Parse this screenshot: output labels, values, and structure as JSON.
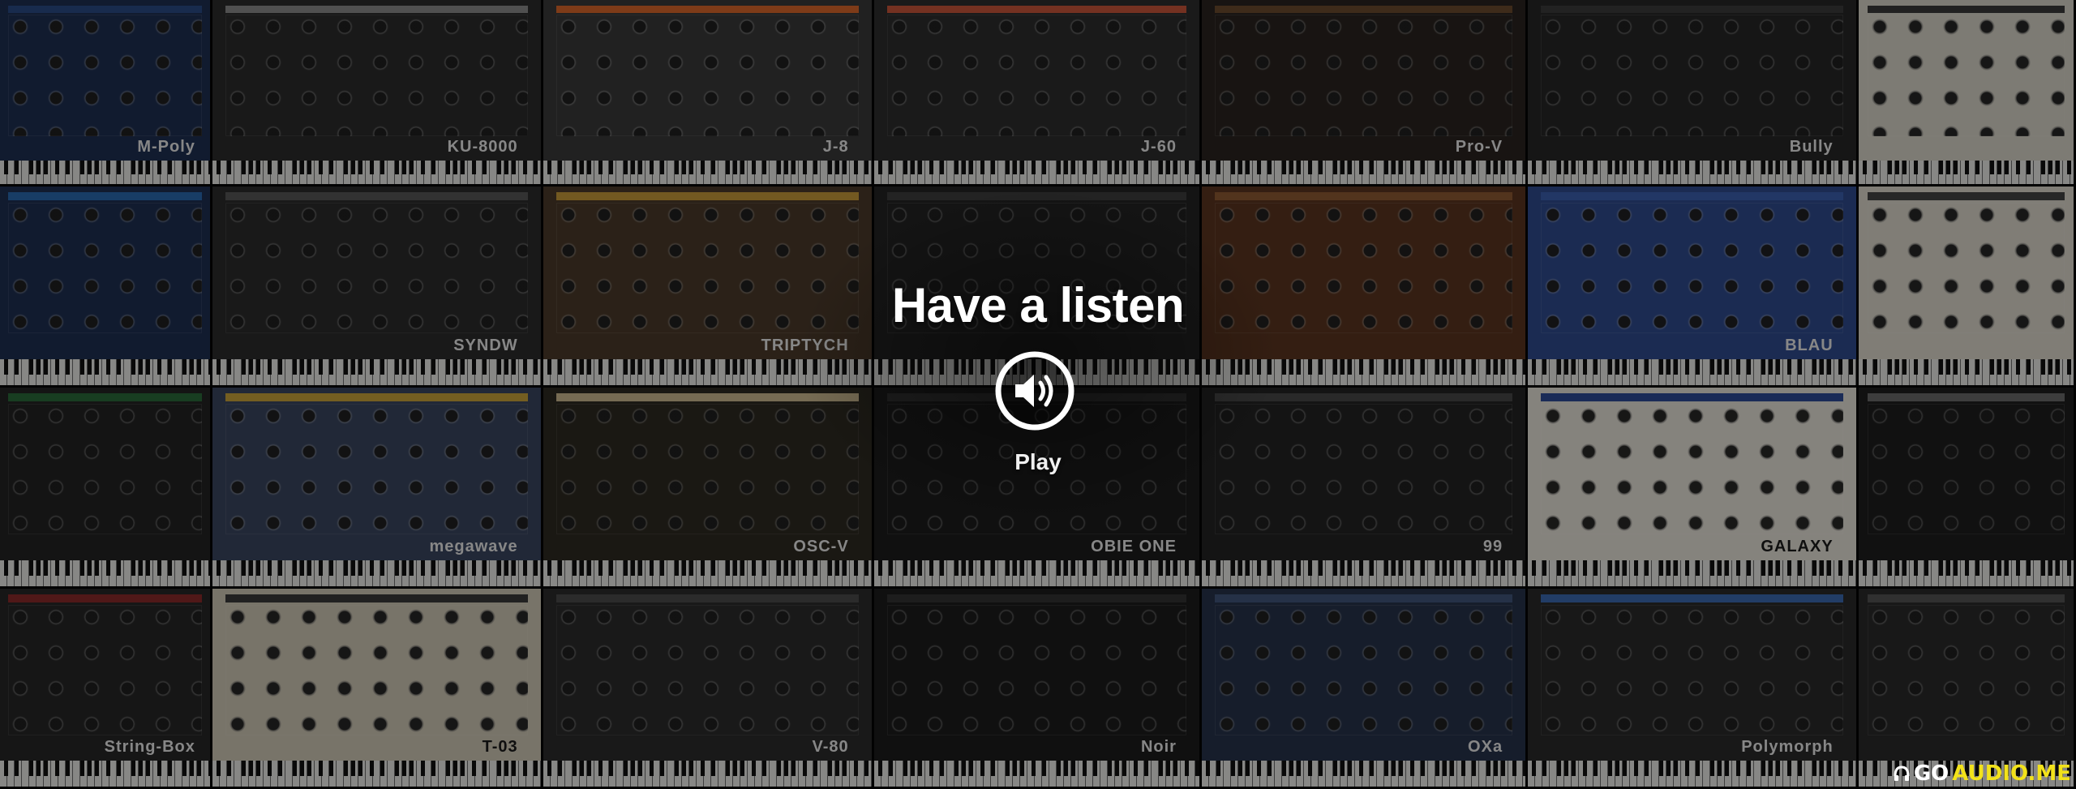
{
  "hero": {
    "headline": "Have a listen",
    "play_label": "Play"
  },
  "watermark": {
    "part1": "GO",
    "part2": "AUDIO.ME"
  },
  "synths": [
    {
      "name": "M-Poly",
      "bg": "#1e2f52",
      "bar": "#2a4a86",
      "light": false
    },
    {
      "name": "KU-8000",
      "bg": "#2b2b2b",
      "bar": "#8a8a8a",
      "light": false
    },
    {
      "name": "J-8",
      "bg": "#3a3a3a",
      "bar": "#d9662a",
      "light": false
    },
    {
      "name": "J-60",
      "bg": "#2d2d2d",
      "bar": "#c8553a",
      "light": false
    },
    {
      "name": "Pro-V",
      "bg": "#2a2420",
      "bar": "#6b4a2d",
      "light": false
    },
    {
      "name": "Bully",
      "bg": "#262626",
      "bar": "#3b3b3b",
      "light": false
    },
    {
      "name": "",
      "bg": "#d8d4c8",
      "bar": "#3a3a3a",
      "light": true
    },
    {
      "name": "",
      "bg": "#1e2f52",
      "bar": "#2a6ab0",
      "light": false
    },
    {
      "name": "SYNDW",
      "bg": "#2b2b2b",
      "bar": "#575757",
      "light": false
    },
    {
      "name": "TRIPTYCH",
      "bg": "#4a3a2a",
      "bar": "#c79a3a",
      "light": false
    },
    {
      "name": "",
      "bg": "#232323",
      "bar": "#3d3d3d",
      "light": false
    },
    {
      "name": "",
      "bg": "#5a3520",
      "bar": "#8e5a32",
      "light": false
    },
    {
      "name": "BLAU",
      "bg": "#2f4a8e",
      "bar": "#3b5fae",
      "light": false
    },
    {
      "name": "",
      "bg": "#dcd8cc",
      "bar": "#444444",
      "light": true
    },
    {
      "name": "",
      "bg": "#232323",
      "bar": "#2a6a3a",
      "light": false
    },
    {
      "name": "megawave",
      "bg": "#3a4660",
      "bar": "#c8a23a",
      "light": false
    },
    {
      "name": "OSC-V",
      "bg": "#2e2a22",
      "bar": "#cbb890",
      "light": false
    },
    {
      "name": "OBIE ONE",
      "bg": "#1c1c1c",
      "bar": "#333333",
      "light": false
    },
    {
      "name": "99",
      "bg": "#242424",
      "bar": "#474747",
      "light": false
    },
    {
      "name": "GALAXY",
      "bg": "#e6e2d8",
      "bar": "#2e4a96",
      "light": true
    },
    {
      "name": "",
      "bg": "#1e1e1e",
      "bar": "#6a6a6a",
      "light": false
    },
    {
      "name": "String-Box",
      "bg": "#262626",
      "bar": "#8a2a2a",
      "light": false
    },
    {
      "name": "T-03",
      "bg": "#cfc8b6",
      "bar": "#3a3a3a",
      "light": true
    },
    {
      "name": "V-80",
      "bg": "#2c2c2c",
      "bar": "#4a4a4a",
      "light": false
    },
    {
      "name": "Noir",
      "bg": "#1d1d1d",
      "bar": "#333333",
      "light": false
    },
    {
      "name": "OXa",
      "bg": "#26324a",
      "bar": "#41557a",
      "light": false
    },
    {
      "name": "Polymorph",
      "bg": "#2a2a2a",
      "bar": "#3c6ab0",
      "light": false
    },
    {
      "name": "",
      "bg": "#2a2a2a",
      "bar": "#545454",
      "light": false
    }
  ]
}
